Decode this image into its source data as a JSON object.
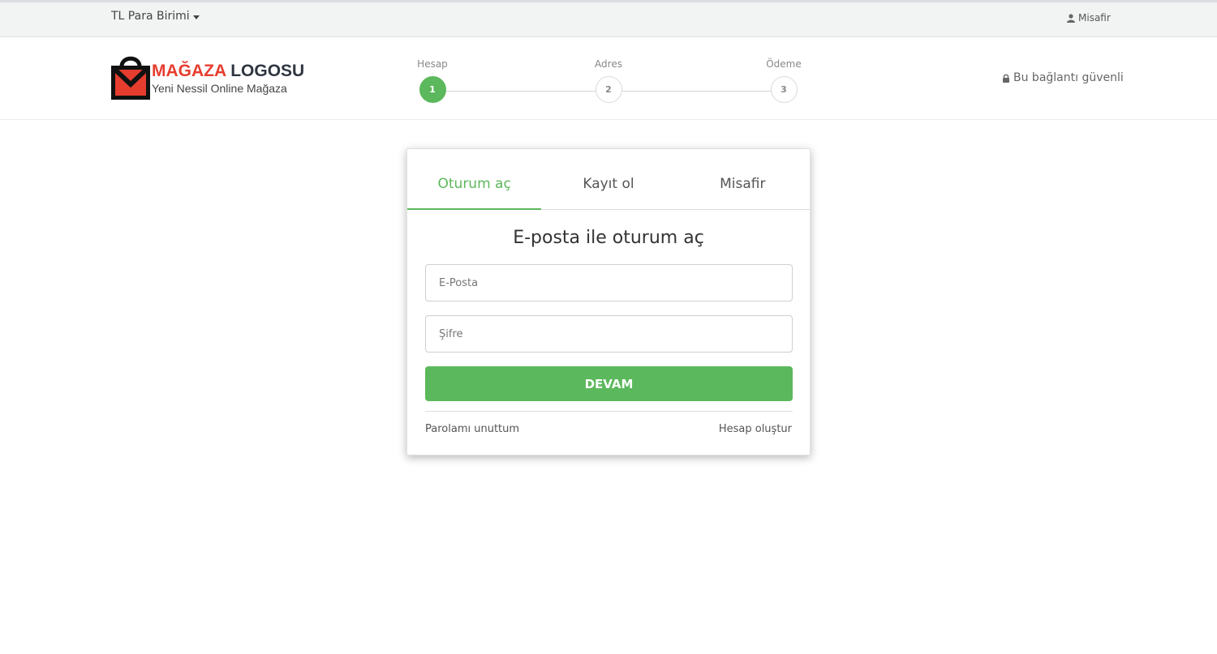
{
  "topbar": {
    "currency_label": "TL Para Birimi",
    "guest_label": "Misafir"
  },
  "header": {
    "logo": {
      "brand_red": "MAĞAZA",
      "brand_dark": "LOGOSU",
      "tagline": "Yeni Nessil Online Mağaza"
    },
    "steps": [
      {
        "label": "Hesap",
        "number": "1",
        "active": true
      },
      {
        "label": "Adres",
        "number": "2",
        "active": false
      },
      {
        "label": "Ödeme",
        "number": "3",
        "active": false
      }
    ],
    "secure_text": "Bu bağlantı güvenli"
  },
  "login": {
    "tabs": [
      {
        "label": "Oturum aç",
        "active": true
      },
      {
        "label": "Kayıt ol",
        "active": false
      },
      {
        "label": "Misafir",
        "active": false
      }
    ],
    "title": "E-posta ile oturum aç",
    "email_placeholder": "E-Posta",
    "email_value": "",
    "password_placeholder": "Şifre",
    "password_value": "",
    "submit_label": "DEVAM",
    "forgot_link": "Parolamı unuttum",
    "create_link": "Hesap oluştur"
  },
  "colors": {
    "accent": "#5cb85c",
    "brand_red": "#e63d2f",
    "topbar_bg": "#f2f3f3"
  },
  "icons": {
    "user": "user-icon",
    "lock": "lock-icon",
    "caret": "caret-down-icon",
    "logo": "shopping-bag-logo-icon"
  }
}
